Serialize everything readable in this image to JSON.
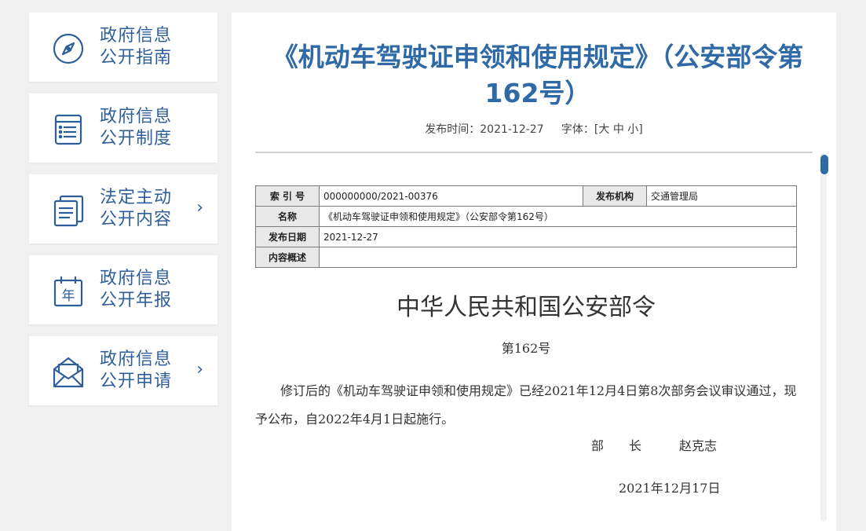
{
  "sidebar": {
    "items": [
      {
        "line1": "政府信息",
        "line2": "公开指南",
        "icon": "compass-icon",
        "has_arrow": false
      },
      {
        "line1": "政府信息",
        "line2": "公开制度",
        "icon": "list-document-icon",
        "has_arrow": false
      },
      {
        "line1": "法定主动",
        "line2": "公开内容",
        "icon": "documents-stack-icon",
        "has_arrow": true
      },
      {
        "line1": "政府信息",
        "line2": "公开年报",
        "icon": "calendar-year-icon",
        "has_arrow": true
      },
      {
        "line1": "政府信息",
        "line2": "公开申请",
        "icon": "mail-open-icon",
        "has_arrow": true
      }
    ],
    "arrow_glyph": "›",
    "colors": {
      "text": "#2f5f99"
    }
  },
  "article": {
    "title": "《机动车驾驶证申领和使用规定》（公安部令第162号）",
    "publish_label": "发布时间：",
    "publish_date": "2021-12-27",
    "font_label": "字体：",
    "font_bracket_open": "[",
    "font_large": "大",
    "font_medium": "中",
    "font_small": "小",
    "font_bracket_close": "]",
    "colors": {
      "title": "#2f6aa7",
      "scroll_thumb": "#2d6aa6"
    }
  },
  "info_table": {
    "index_label": "索 引 号",
    "index_value": "000000000/2021-00376",
    "org_label": "发布机构",
    "org_value": "交通管理局",
    "name_label": "名称",
    "name_value": "《机动车驾驶证申领和使用规定》（公安部令第162号）",
    "date_label": "发布日期",
    "date_value": "2021-12-27",
    "summary_label": "内容概述",
    "summary_value": ""
  },
  "document": {
    "issuer": "中华人民共和国公安部令",
    "number": "第162号",
    "body": "修订后的《机动车驾驶证申领和使用规定》已经2021年12月4日第8次部务会议审议通过，现予公布，自2022年4月1日起施行。",
    "signer_title": "部　　长",
    "signer_name": "赵克志",
    "sign_date": "2021年12月17日"
  }
}
